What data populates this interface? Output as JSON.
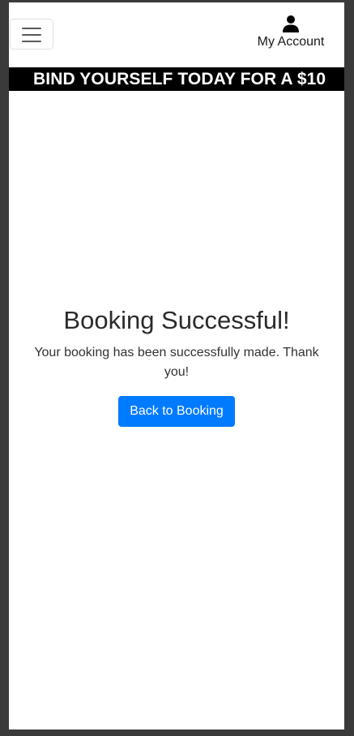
{
  "navbar": {
    "menu_icon": "hamburger-menu-icon",
    "account_icon": "user-icon",
    "account_label": "My Account"
  },
  "ticker": {
    "text": "BIND YOURSELF TODAY FOR A $10"
  },
  "main": {
    "title": "Booking Successful!",
    "message": "Your booking has been successfully made. Thank you!",
    "button_label": "Back to Booking"
  },
  "colors": {
    "primary_button": "#007bff",
    "ticker_background": "#000000",
    "page_background": "#ffffff",
    "outer_background": "#3a3a3a"
  }
}
